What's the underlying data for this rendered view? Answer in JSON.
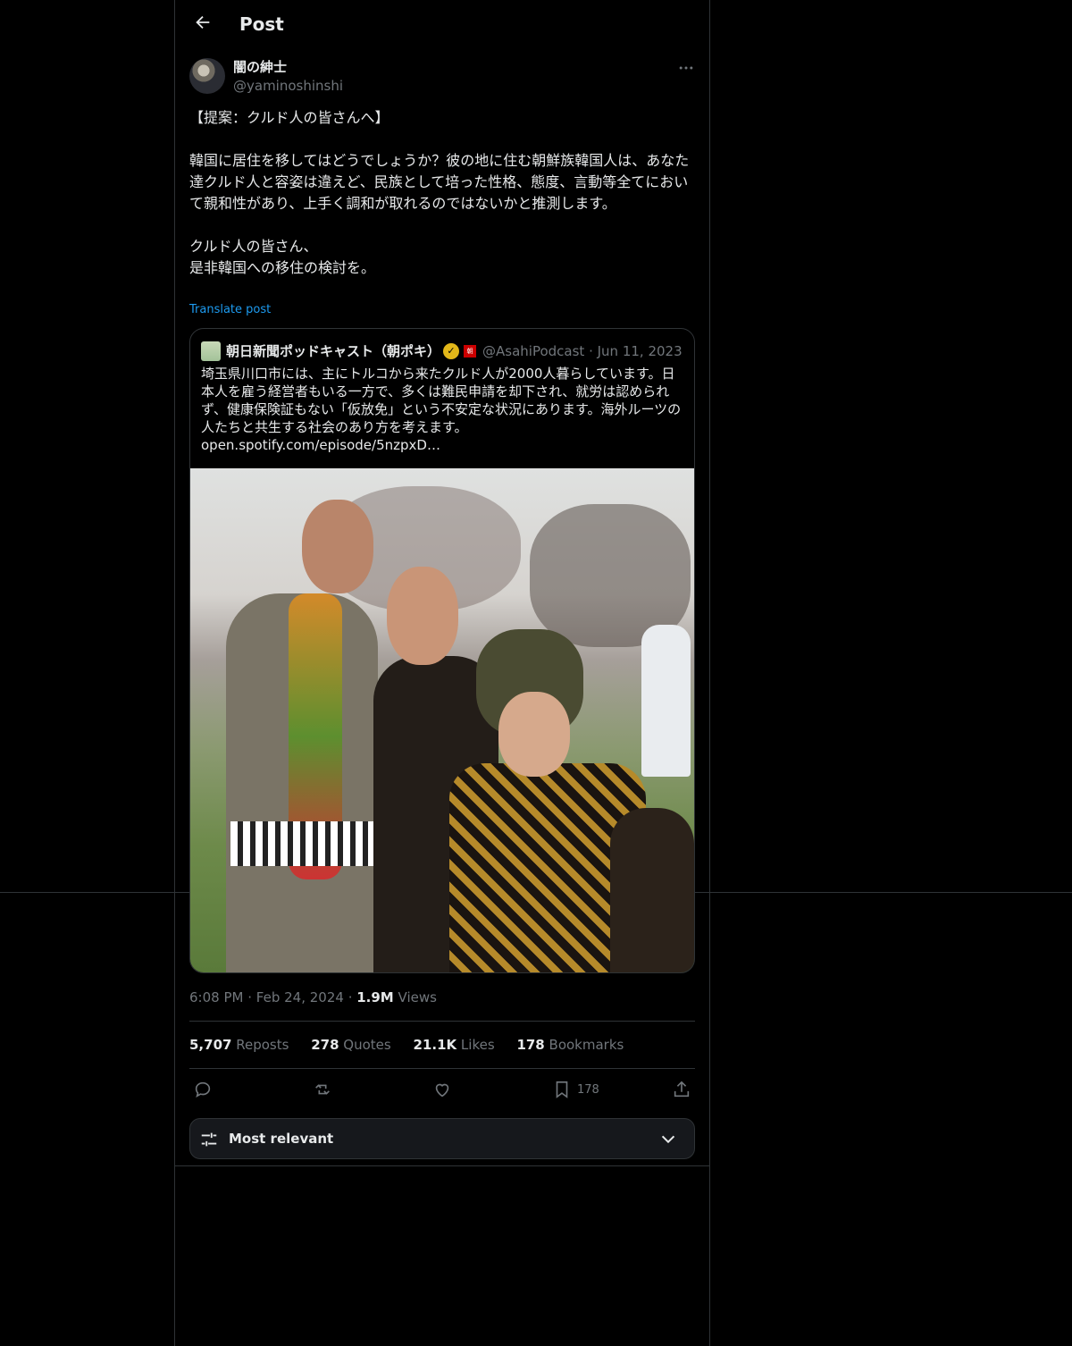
{
  "header": {
    "title": "Post"
  },
  "author": {
    "name": "闇の紳士",
    "handle": "@yaminoshinshi"
  },
  "post": {
    "text": "【提案：クルド人の皆さんへ】\n\n韓国に居住を移してはどうでしょうか？彼の地に住む朝鮮族韓国人は、あなた達クルド人と容姿は違えど、民族として培った性格、態度、言動等全てにおいて親和性があり、上手く調和が取れるのではないかと推測します。\n\nクルド人の皆さん、\n是非韓国への移住の検討を。",
    "translate_label": "Translate post"
  },
  "quote": {
    "name": "朝日新聞ポッドキャスト（朝ポキ）",
    "badge": "朝",
    "handle": "@AsahiPodcast",
    "date": "Jun 11, 2023",
    "text": "埼玉県川口市には、主にトルコから来たクルド人が2000人暮らしています。日本人を雇う経営者もいる一方で、多くは難民申請を却下され、就労は認められず、健康保険証もない「仮放免」という不安定な状況にあります。海外ルーツの人たちと共生する社会のあり方を考えます。",
    "link": "open.spotify.com/episode/5nzpxD…"
  },
  "meta": {
    "time": "6:08 PM",
    "date": "Feb 24, 2024",
    "views_count": "1.9M",
    "views_label": "Views"
  },
  "stats": [
    {
      "count": "5,707",
      "label": "Reposts"
    },
    {
      "count": "278",
      "label": "Quotes"
    },
    {
      "count": "21.1K",
      "label": "Likes"
    },
    {
      "count": "178",
      "label": "Bookmarks"
    }
  ],
  "actions": {
    "bookmark_count": "178"
  },
  "sort": {
    "label": "Most relevant"
  },
  "colors": {
    "background": "#000000",
    "border": "#2f3336",
    "link": "#1d9bf0",
    "muted": "#71767b",
    "text": "#e7e9ea"
  }
}
